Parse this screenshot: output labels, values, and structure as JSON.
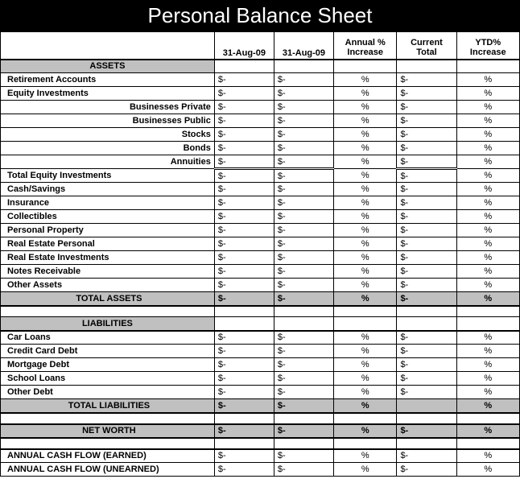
{
  "title": "Personal Balance Sheet",
  "headers": {
    "col1": "31-Aug-09",
    "col2": "31-Aug-09",
    "col3": "Annual % Increase",
    "col4": "Current Total",
    "col5": "YTD% Increase"
  },
  "assets": {
    "section_title": "ASSETS",
    "rows": [
      {
        "label": "Retirement Accounts",
        "v1": "$-",
        "v2": "$-",
        "p1": "%",
        "v3": "$-",
        "p2": "%",
        "sub": false
      },
      {
        "label": "Equity Investments",
        "v1": "$-",
        "v2": "$-",
        "p1": "%",
        "v3": "$-",
        "p2": "%",
        "sub": false
      },
      {
        "label": "Businesses Private",
        "v1": "$-",
        "v2": "$-",
        "p1": "%",
        "v3": "$-",
        "p2": "%",
        "sub": true
      },
      {
        "label": "Businesses Public",
        "v1": "$-",
        "v2": "$-",
        "p1": "%",
        "v3": "$-",
        "p2": "%",
        "sub": true
      },
      {
        "label": "Stocks",
        "v1": "$-",
        "v2": "$-",
        "p1": "%",
        "v3": "$-",
        "p2": "%",
        "sub": true
      },
      {
        "label": "Bonds",
        "v1": "$-",
        "v2": "$-",
        "p1": "%",
        "v3": "$-",
        "p2": "%",
        "sub": true
      },
      {
        "label": "Annuities",
        "v1": "$-",
        "v2": "$-",
        "p1": "%",
        "v3": "$-",
        "p2": "%",
        "sub": true,
        "dbl": true
      },
      {
        "label": "Total Equity Investments",
        "v1": "$-",
        "v2": "$-",
        "p1": "%",
        "v3": "$-",
        "p2": "%",
        "sub": false
      },
      {
        "label": "Cash/Savings",
        "v1": "$-",
        "v2": "$-",
        "p1": "%",
        "v3": "$-",
        "p2": "%",
        "sub": false
      },
      {
        "label": "Insurance",
        "v1": "$-",
        "v2": "$-",
        "p1": "%",
        "v3": "$-",
        "p2": "%",
        "sub": false
      },
      {
        "label": "Collectibles",
        "v1": "$-",
        "v2": "$-",
        "p1": "%",
        "v3": "$-",
        "p2": "%",
        "sub": false
      },
      {
        "label": "Personal Property",
        "v1": "$-",
        "v2": "$-",
        "p1": "%",
        "v3": "$-",
        "p2": "%",
        "sub": false
      },
      {
        "label": "Real Estate Personal",
        "v1": "$-",
        "v2": "$-",
        "p1": "%",
        "v3": "$-",
        "p2": "%",
        "sub": false
      },
      {
        "label": "Real Estate Investments",
        "v1": "$-",
        "v2": "$-",
        "p1": "%",
        "v3": "$-",
        "p2": "%",
        "sub": false
      },
      {
        "label": "Notes Receivable",
        "v1": "$-",
        "v2": "$-",
        "p1": "%",
        "v3": "$-",
        "p2": "%",
        "sub": false
      },
      {
        "label": "Other Assets",
        "v1": "$-",
        "v2": "$-",
        "p1": "%",
        "v3": "$-",
        "p2": "%",
        "sub": false
      }
    ],
    "total": {
      "label": "TOTAL ASSETS",
      "v1": "$-",
      "v2": "$-",
      "p1": "%",
      "v3": "$-",
      "p2": "%"
    }
  },
  "liabilities": {
    "section_title": "LIABILITIES",
    "rows": [
      {
        "label": "Car Loans",
        "v1": "$-",
        "v2": "$-",
        "p1": "%",
        "v3": "$-",
        "p2": "%"
      },
      {
        "label": "Credit Card Debt",
        "v1": "$-",
        "v2": "$-",
        "p1": "%",
        "v3": "$-",
        "p2": "%"
      },
      {
        "label": "Mortgage Debt",
        "v1": "$-",
        "v2": "$-",
        "p1": "%",
        "v3": "$-",
        "p2": "%"
      },
      {
        "label": "School Loans",
        "v1": "$-",
        "v2": "$-",
        "p1": "%",
        "v3": "$-",
        "p2": "%"
      },
      {
        "label": "Other Debt",
        "v1": "$-",
        "v2": "$-",
        "p1": "%",
        "v3": "$-",
        "p2": "%"
      }
    ],
    "total": {
      "label": "TOTAL LIABILITIES",
      "v1": "$-",
      "v2": "$-",
      "p1": "%",
      "v3": "",
      "p2": "%"
    }
  },
  "networth": {
    "label": "NET WORTH",
    "v1": "$-",
    "v2": "$-",
    "p1": "%",
    "v3": "$-",
    "p2": "%"
  },
  "cashflows": [
    {
      "label": "ANNUAL CASH FLOW  (EARNED)",
      "v1": "$-",
      "v2": "$-",
      "p1": "%",
      "v3": "$-",
      "p2": "%"
    },
    {
      "label": "ANNUAL CASH FLOW (UNEARNED)",
      "v1": "$-",
      "v2": "$-",
      "p1": "%",
      "v3": "$-",
      "p2": "%"
    }
  ]
}
